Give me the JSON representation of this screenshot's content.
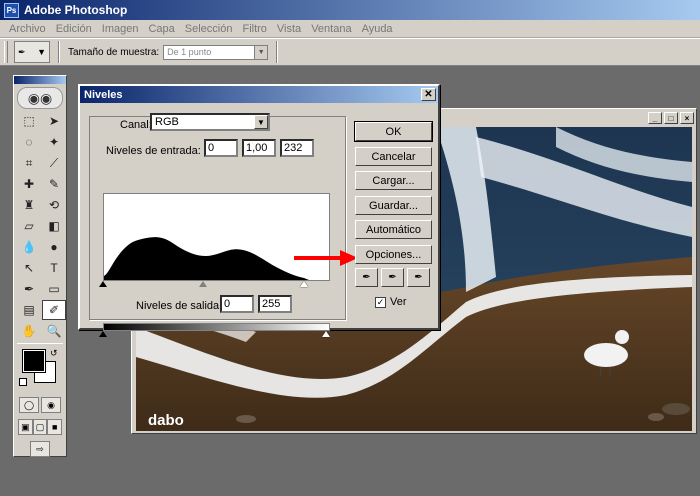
{
  "app": {
    "title": "Adobe Photoshop"
  },
  "menu": [
    "Archivo",
    "Edición",
    "Imagen",
    "Capa",
    "Selección",
    "Filtro",
    "Vista",
    "Ventana",
    "Ayuda"
  ],
  "options": {
    "sample_label": "Tamaño de muestra:",
    "sample_value": "De 1 punto"
  },
  "watermark": "dabo",
  "dialog": {
    "title": "Niveles",
    "channel_label": "Canal:",
    "channel_value": "RGB",
    "input_label": "Niveles de entrada:",
    "input_values": [
      "0",
      "1,00",
      "232"
    ],
    "output_label": "Niveles de salida:",
    "output_values": [
      "0",
      "255"
    ],
    "buttons": [
      "OK",
      "Cancelar",
      "Cargar...",
      "Guardar...",
      "Automático",
      "Opciones..."
    ],
    "preview_label": "Ver",
    "preview_checked": true
  },
  "colors": {
    "accent": "#0a246a",
    "arrow": "#ff0000",
    "chrome": "#d4d0c8"
  },
  "icons": [
    "photoshop-logo",
    "eyedropper-icon",
    "close-icon",
    "minimize-icon",
    "maximize-icon"
  ]
}
